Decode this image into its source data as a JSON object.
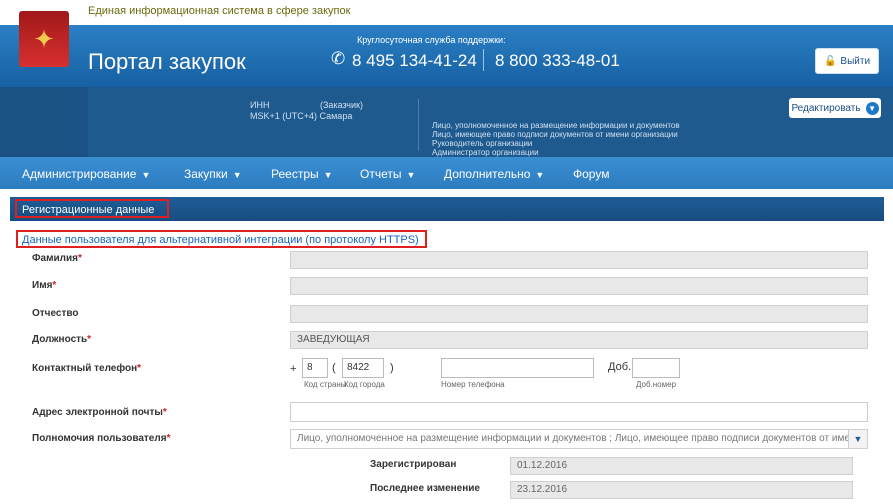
{
  "header": {
    "system_title": "Единая информационная система в сфере закупок",
    "portal_title": "Портал закупок",
    "support_label": "Круглосуточная служба поддержки:",
    "phone_1": "8 495 134-41-24",
    "phone_2": "8 800 333-48-01",
    "logout_label": "Выйти",
    "emblem_icon": "coat-of-arms-icon"
  },
  "info": {
    "inn_label": "ИНН",
    "role": "(Заказчик)",
    "timezone": "MSK+1 (UTC+4) Самара",
    "roles": [
      "Лицо, уполномоченное на размещение информации и документов",
      "Лицо, имеющее право подписи документов от имени организации",
      "Руководитель организации",
      "Администратор организации"
    ],
    "edit_label": "Редактировать"
  },
  "nav": {
    "items": [
      "Администрирование",
      "Закупки",
      "Реестры",
      "Отчеты",
      "Дополнительно",
      "Форум"
    ]
  },
  "tabs": {
    "registration": "Регистрационные данные",
    "https_link": "Данные пользователя для альтернативной интеграции (по протоколу HTTPS)"
  },
  "form": {
    "lastname_label": "Фамилия",
    "firstname_label": "Имя",
    "patronymic_label": "Отчество",
    "position_label": "Должность",
    "position_value": "ЗАВЕДУЮЩАЯ",
    "phone_label": "Контактный телефон",
    "phone_plus": "+",
    "country_code": "8",
    "city_code": "8422",
    "country_code_label": "Код страны",
    "city_code_label": "Код города",
    "phone_number_label": "Номер телефона",
    "ext_label": "Доб.",
    "ext_number_label": "Доб.номер",
    "email_label": "Адрес электронной почты",
    "authority_label": "Полномочия пользователя",
    "authority_value": "Лицо, уполномоченное на размещение информации и документов ; Лицо, имеющее право подписи документов от имени",
    "registered_label": "Зарегистрирован",
    "registered_value": "01.12.2016",
    "modified_label": "Последнее изменение",
    "modified_value": "23.12.2016",
    "required_mark": "*"
  },
  "colors": {
    "header_blue": "#1f6fb6",
    "info_dark_blue": "#1f5a8f",
    "nav_blue": "#3a8fd2",
    "highlight_red": "#e02020",
    "link_blue": "#1565b8"
  }
}
